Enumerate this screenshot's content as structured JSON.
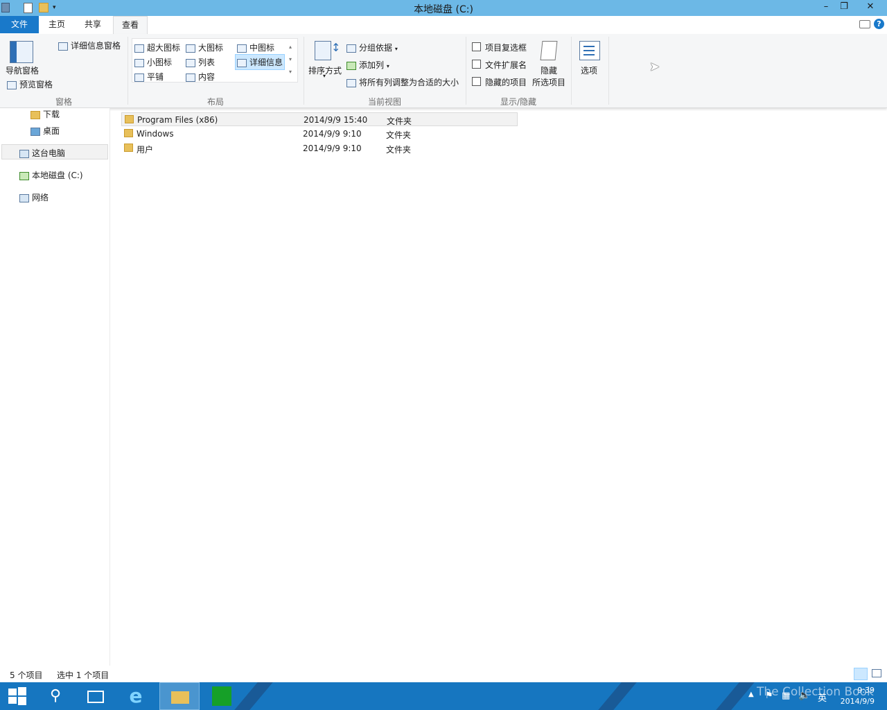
{
  "window": {
    "title": "本地磁盘 (C:)"
  },
  "title_buttons": {
    "minimize": "–",
    "restore": "❐",
    "close": "✕"
  },
  "tabs": [
    {
      "label": "文件"
    },
    {
      "label": "主页"
    },
    {
      "label": "共享"
    },
    {
      "label": "查看"
    }
  ],
  "ribbon": {
    "panes": {
      "label": "窗格",
      "nav_pane": "导航窗格",
      "preview_pane": "预览窗格",
      "details_pane": "详细信息窗格"
    },
    "layout": {
      "label": "布局",
      "options": [
        "超大图标",
        "大图标",
        "中图标",
        "小图标",
        "列表",
        "详细信息",
        "平铺",
        "内容"
      ],
      "selected": "详细信息"
    },
    "current_view": {
      "label": "当前视图",
      "sort_by": "排序方式",
      "group_by": "分组依据",
      "add_columns": "添加列",
      "size_all_columns": "将所有列调整为合适的大小"
    },
    "show_hide": {
      "label": "显示/隐藏",
      "item_checkboxes": "项目复选框",
      "file_extensions": "文件扩展名",
      "hidden_items": "隐藏的项目",
      "hide_selected_1": "隐藏",
      "hide_selected_2": "所选项目"
    },
    "options": {
      "label": "选项"
    }
  },
  "nav": {
    "items": [
      {
        "label": "下载"
      },
      {
        "label": "桌面"
      },
      {
        "label": "这台电脑"
      },
      {
        "label": "本地磁盘 (C:)"
      },
      {
        "label": "网络"
      }
    ]
  },
  "files": [
    {
      "name": "Program Files (x86)",
      "date": "2014/9/9 15:40",
      "type": "文件夹",
      "selected": true
    },
    {
      "name": "Windows",
      "date": "2014/9/9 9:10",
      "type": "文件夹",
      "selected": false
    },
    {
      "name": "用户",
      "date": "2014/9/9 9:10",
      "type": "文件夹",
      "selected": false
    }
  ],
  "status": {
    "item_count": "5 个项目",
    "selected_count": "选中 1 个项目"
  },
  "taskbar": {
    "tray_lang": "英",
    "time": "9:39",
    "date": "2014/9/9",
    "watermark": "The Collection Book"
  },
  "colors": {
    "titlebar": "#6cb8e6",
    "file_tab": "#1979ca",
    "taskbar": "#1676c0",
    "selection": "#cce8ff"
  }
}
